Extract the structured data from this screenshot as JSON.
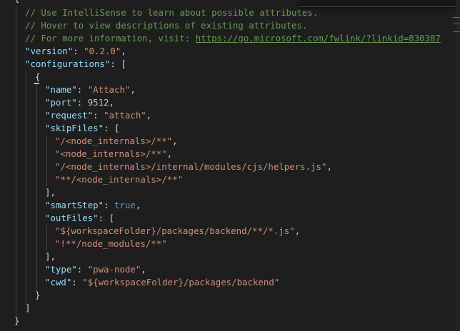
{
  "editor": {
    "comments": [
      "// Use IntelliSense to learn about possible attributes.",
      "// Hover to view descriptions of existing attributes.",
      "// For more information, visit: "
    ],
    "comment_link": "https://go.microsoft.com/fwlink/?linkid=830387",
    "version_key": "\"version\"",
    "version_value": "\"0.2.0\"",
    "configurations_key": "\"configurations\"",
    "config": {
      "name_key": "\"name\"",
      "name_value": "\"Attach\"",
      "port_key": "\"port\"",
      "port_value": "9512",
      "request_key": "\"request\"",
      "request_value": "\"attach\"",
      "skipFiles_key": "\"skipFiles\"",
      "skipFiles": [
        "\"/<node_internals>/**\"",
        "\"<node_internals>/**\"",
        "\"/<node_internals>/internal/modules/cjs/helpers.js\"",
        "\"**/<node_internals>/**\""
      ],
      "smartStep_key": "\"smartStep\"",
      "smartStep_value": "true",
      "outFiles_key": "\"outFiles\"",
      "outFiles": [
        "\"${workspaceFolder}/packages/backend/**/*.js\"",
        "\"!**/node_modules/**\""
      ],
      "type_key": "\"type\"",
      "type_value": "\"pwa-node\"",
      "cwd_key": "\"cwd\"",
      "cwd_value": "\"${workspaceFolder}/packages/backend\""
    }
  },
  "colors": {
    "background": "#1e1e1e",
    "comment": "#6a9955",
    "key": "#9cdcfe",
    "string": "#ce9178",
    "number": "#b5cea8",
    "keyword": "#569cd6",
    "lightbulb": "#e6b422"
  },
  "icons": {
    "lightbulb": "lightbulb-icon"
  }
}
